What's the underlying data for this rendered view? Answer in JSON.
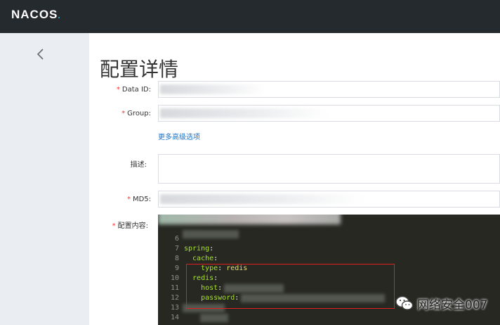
{
  "header": {
    "logo_text": "NACOS",
    "logo_dot": "."
  },
  "sidebar": {
    "back_icon": "chevron-left-icon"
  },
  "page": {
    "title": "配置详情",
    "advanced_link": "更多高级选项"
  },
  "form": {
    "data_id_label": "Data ID:",
    "group_label": "Group:",
    "desc_label": "描述:",
    "md5_label": "MD5:",
    "content_label": "配置内容:",
    "required_mark": "*"
  },
  "editor": {
    "line_numbers": [
      "6",
      "7",
      "8",
      "9",
      "10",
      "11",
      "12",
      "13",
      "14"
    ],
    "lines": [
      {
        "ln": "6",
        "key": "",
        "value": ""
      },
      {
        "ln": "7",
        "key": "spring",
        "value": ""
      },
      {
        "ln": "8",
        "key": "  cache",
        "value": ""
      },
      {
        "ln": "9",
        "key": "    type",
        "value": "redis"
      },
      {
        "ln": "10",
        "key": "  redis",
        "value": ""
      },
      {
        "ln": "11",
        "key": "    host",
        "value": ""
      },
      {
        "ln": "12",
        "key": "    password",
        "value": ""
      },
      {
        "ln": "13",
        "key": "",
        "value": ""
      },
      {
        "ln": "14",
        "key": "",
        "value": ""
      }
    ]
  },
  "watermark": {
    "text": "网络安全007",
    "icon": "wechat-icon"
  },
  "colors": {
    "topbar": "#252a2f",
    "sidebar": "#eaedf1",
    "editor_bg": "#272822",
    "key": "#a6e22e",
    "string": "#e6db74",
    "link": "#1a73c9",
    "required": "#ff3333",
    "highlight_box": "#e02020"
  }
}
